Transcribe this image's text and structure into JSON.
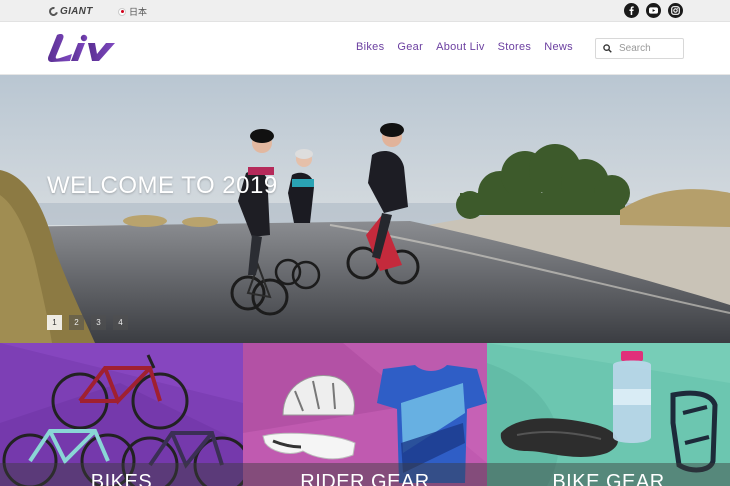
{
  "topbar": {
    "giant_logo": "GIANT",
    "language": "日本",
    "social": [
      "facebook-icon",
      "youtube-icon",
      "instagram-icon"
    ]
  },
  "header": {
    "logo": "Liv",
    "nav": [
      "Bikes",
      "Gear",
      "About Liv",
      "Stores",
      "News"
    ],
    "search_placeholder": "Search"
  },
  "hero": {
    "title": "WELCOME TO 2019",
    "slides": [
      "1",
      "2",
      "3",
      "4"
    ],
    "active_slide": 1
  },
  "tiles": [
    {
      "label": "BIKES",
      "color": "#7d3fb5"
    },
    {
      "label": "RIDER GEAR",
      "color": "#c05ab0"
    },
    {
      "label": "BIKE GEAR",
      "color": "#6cc6b0"
    }
  ],
  "colors": {
    "brand": "#6b3fa0"
  }
}
